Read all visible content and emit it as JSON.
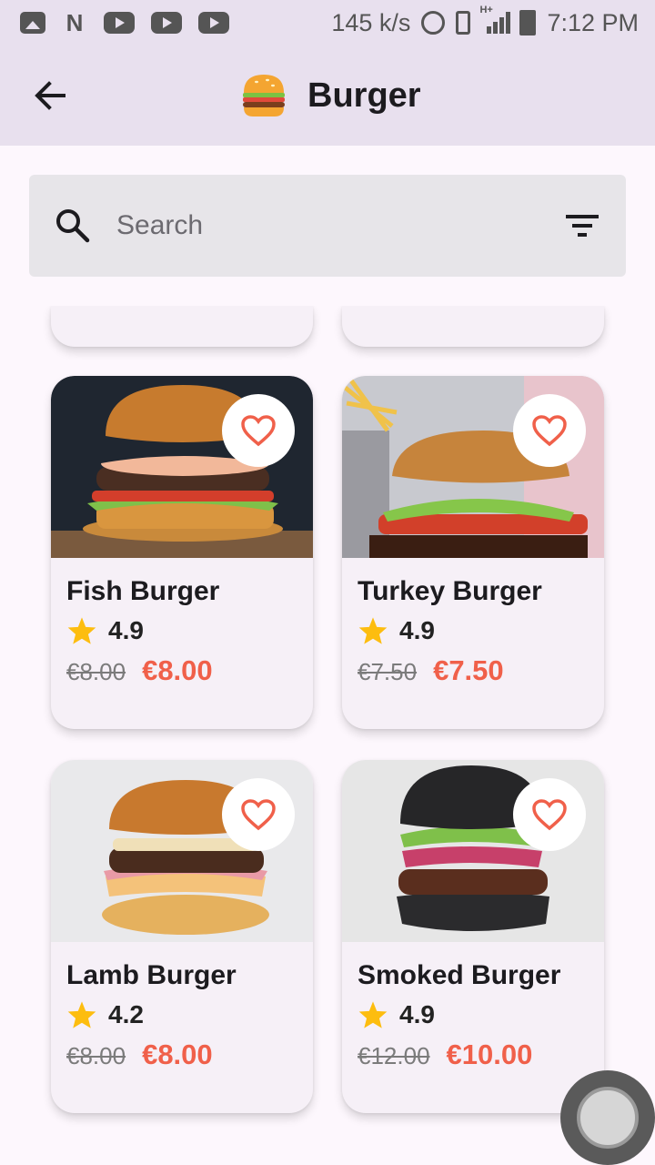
{
  "status_bar": {
    "speed": "145 k/s",
    "network": "H+",
    "time": "7:12 PM",
    "icons": [
      "gallery-icon",
      "n-icon",
      "youtube-icon",
      "youtube-icon",
      "youtube-icon",
      "hotspot-icon",
      "vibrate-icon",
      "signal-icon",
      "battery-icon"
    ]
  },
  "app_bar": {
    "title": "Burger",
    "emoji": "🍔",
    "back_icon": "arrow-back-icon"
  },
  "search": {
    "placeholder": "Search",
    "value": "",
    "filter_icon": "filter-icon"
  },
  "products": [
    {
      "name": "Fish Burger",
      "rating": "4.9",
      "old_price": "€8.00",
      "price": "€8.00",
      "bg": "#1f2630"
    },
    {
      "name": "Turkey Burger",
      "rating": "4.9",
      "old_price": "€7.50",
      "price": "€7.50",
      "bg": "#c8c9cf"
    },
    {
      "name": "Lamb Burger",
      "rating": "4.2",
      "old_price": "€8.00",
      "price": "€8.00",
      "bg": "#e9e9eb"
    },
    {
      "name": "Smoked Burger",
      "rating": "4.9",
      "old_price": "€12.00",
      "price": "€10.00",
      "bg": "#e6e6e6"
    }
  ],
  "colors": {
    "appbar": "#e8e0ee",
    "price": "#f0604a",
    "heart": "#f0604a",
    "star": "#fdbd0f"
  }
}
